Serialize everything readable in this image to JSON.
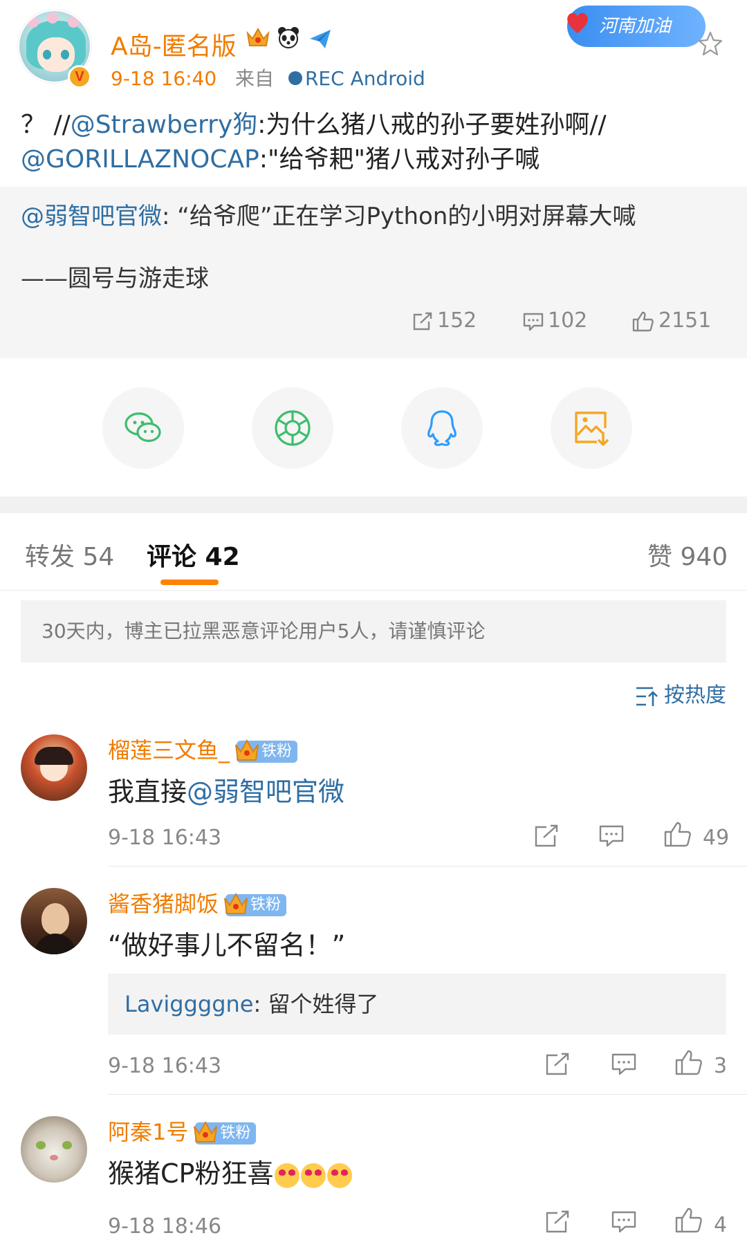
{
  "post": {
    "username": "A岛-匿名版",
    "time": "9-18 16:40",
    "from_label": "来自",
    "source": "REC  Android",
    "badge_text": "河南加油",
    "text_part1": "？ //",
    "mention1": "@Strawberry狗",
    "text_part2": ":为什么猪八戒的孙子要姓孙啊//",
    "mention2": "@GORILLAZNOCAP",
    "text_part3": ":\"给爷耙\"猪八戒对孙子喊"
  },
  "quote": {
    "mention": "@弱智吧官微",
    "text": ": “给爷爬”正在学习Python的小明对屏幕大喊",
    "signature": "——圆号与游走球",
    "reposts": "152",
    "comments": "102",
    "likes": "2151"
  },
  "share": {
    "icons": [
      "wechat-icon",
      "moments-icon",
      "qq-icon",
      "save-image-icon"
    ]
  },
  "tabs": {
    "repost": "转发 54",
    "comment": "评论 42",
    "like": "赞 940"
  },
  "notice": "30天内，博主已拉黑恶意评论用户5人，请谨慎评论",
  "sort_label": "按热度",
  "fan_badge": "铁粉",
  "comments": [
    {
      "name": "榴莲三文鱼_",
      "text_prefix": "我直接",
      "text_mention": "@弱智吧官微",
      "time": "9-18 16:43",
      "likes": "49"
    },
    {
      "name": "酱香猪脚饭",
      "text": "“做好事儿不留名！”",
      "reply_user": "Laviggggne",
      "reply_text": ": 留个姓得了",
      "time": "9-18 16:43",
      "likes": "3"
    },
    {
      "name": "阿秦1号",
      "text": "猴猪CP粉狂喜",
      "time": "9-18 18:46",
      "likes": "4"
    }
  ],
  "colors": {
    "accent_orange": "#f07c00",
    "link_blue": "#2f6ea3",
    "tab_underline": "#ff8200"
  }
}
